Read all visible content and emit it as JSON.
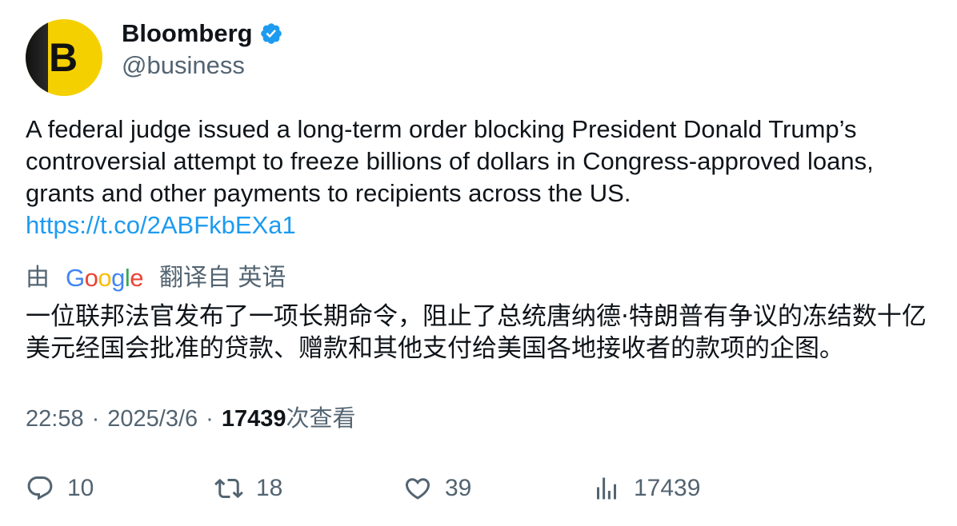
{
  "author": {
    "name": "Bloomberg",
    "handle": "@business",
    "avatar_letter": "B",
    "verified_icon": "verified-badge-icon"
  },
  "tweet": {
    "text": "A federal judge issued a long-term order blocking President Donald Trump’s controversial attempt to freeze billions of dollars in Congress-approved loans, grants and other payments to recipients across the US.",
    "link": "https://t.co/2ABFkbEXa1"
  },
  "translation": {
    "prefix": "由",
    "provider": "Google",
    "suffix": "翻译自 英语",
    "text": "一位联邦法官发布了一项长期命令，阻止了总统唐纳德·特朗普有争议的冻结数十亿美元经国会批准的贷款、赠款和其他支付给美国各地接收者的款项的企图。"
  },
  "meta": {
    "time": "22:58",
    "date": "2025/3/6",
    "separator": "·",
    "views_count": "17439",
    "views_label": "次查看"
  },
  "actions": {
    "replies": "10",
    "retweets": "18",
    "likes": "39",
    "views": "17439"
  },
  "colors": {
    "text": "#0f1419",
    "muted": "#536471",
    "link": "#1d9bf0",
    "avatar_yellow": "#f5d000"
  }
}
